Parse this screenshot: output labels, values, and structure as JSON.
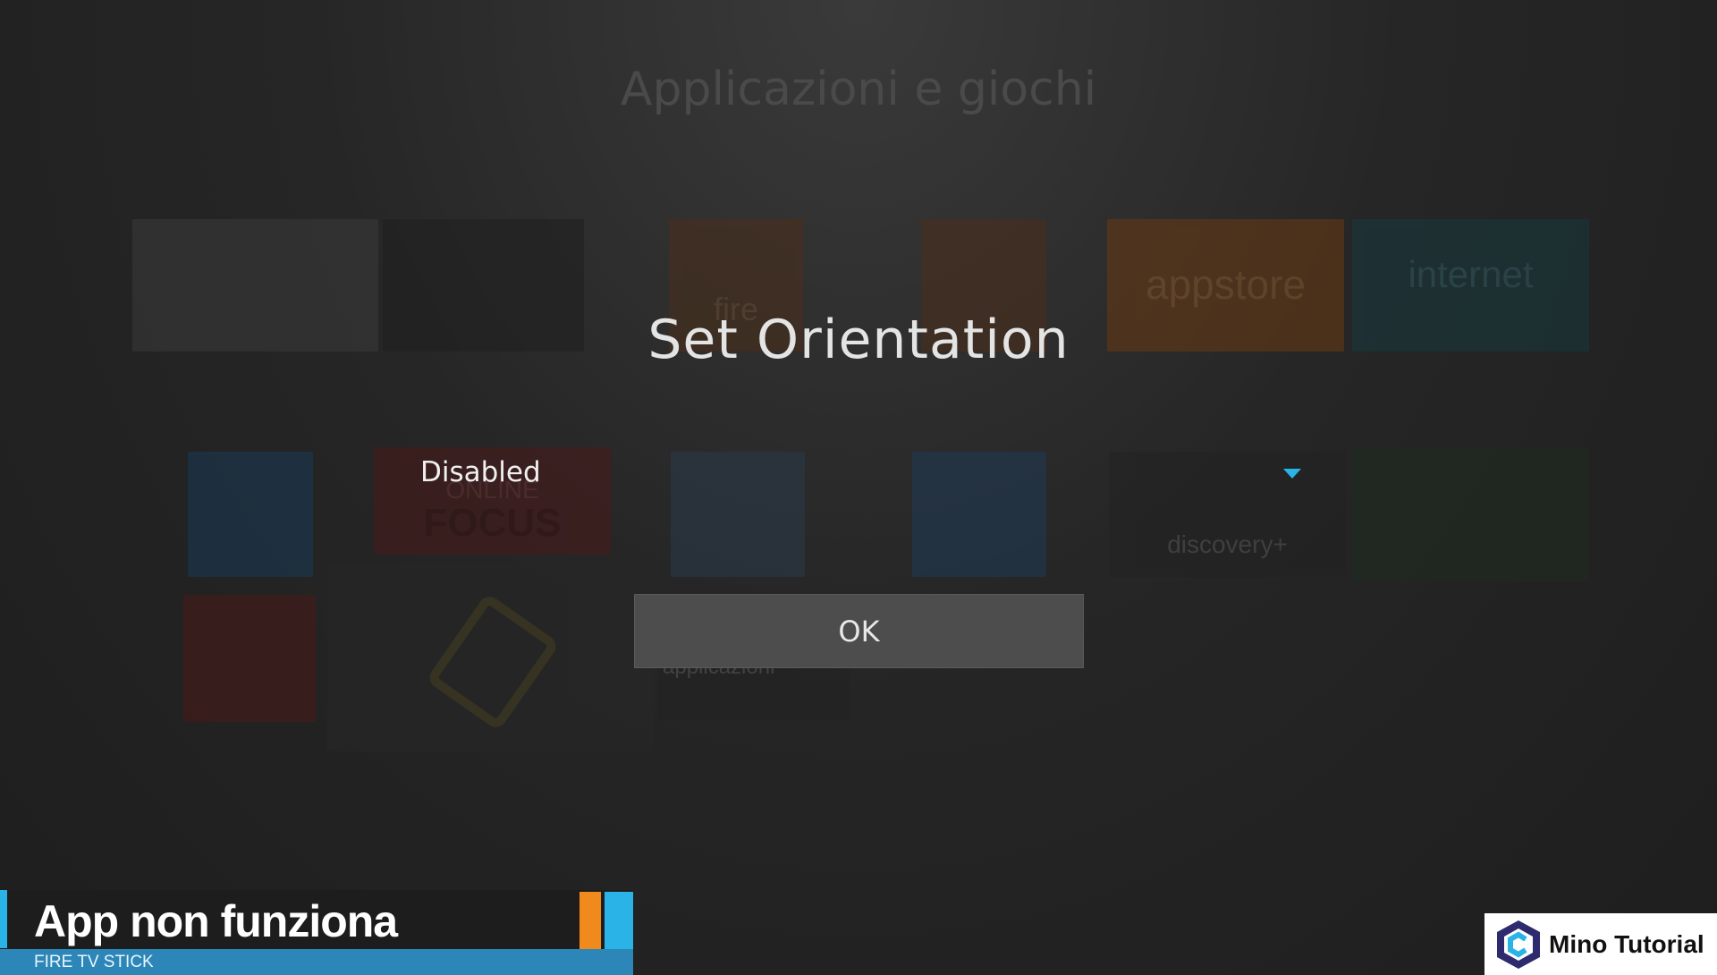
{
  "background": {
    "title": "Applicazioni e giochi",
    "tiles": {
      "appstore": "appstore",
      "internet": "internet",
      "fire": "fire",
      "discovery": "discovery+",
      "focus": "FOCUS",
      "focus_online": "ONLINE",
      "library": "Libreria delle applicazioni"
    }
  },
  "dialog": {
    "title": "Set Orientation",
    "selected_option": "Disabled",
    "ok_label": "OK"
  },
  "overlay": {
    "banner_title": "App non funziona",
    "banner_subtitle": "FIRE TV STICK",
    "logo_text": "Mino Tutorial"
  },
  "colors": {
    "accent_blue": "#2ab3e6",
    "accent_orange": "#f08a1c",
    "appstore_orange": "#8a4a1a",
    "internet_teal": "#1e4f55"
  }
}
